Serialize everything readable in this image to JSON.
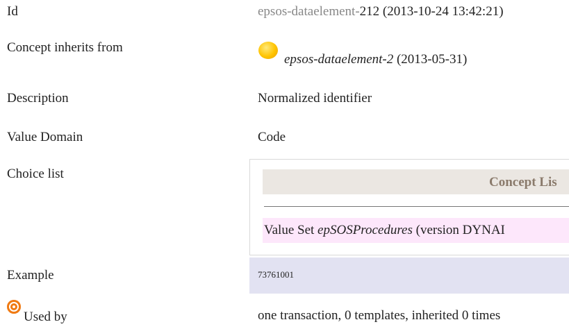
{
  "rows": {
    "id": {
      "label": "Id",
      "value_prefix": "epsos-dataelement-",
      "value_number": "212",
      "value_date": "(2013-10-24 13:42:21)"
    },
    "inherits": {
      "label": "Concept inherits from",
      "value_name": "epsos-dataelement-2",
      "value_date": "(2013-05-31)",
      "icon": "yellow-orb-icon"
    },
    "description": {
      "label": "Description",
      "value": "Normalized identifier"
    },
    "value_domain": {
      "label": "Value Domain",
      "value": "Code"
    },
    "choice_list": {
      "label": "Choice list",
      "concept_list_header": "Concept Lis",
      "value_set_prefix": "Value Set ",
      "value_set_name": "epSOSProcedures",
      "value_set_version": "(version DYNAI"
    },
    "example": {
      "label": "Example",
      "value": "73761001"
    },
    "used_by": {
      "label": "Used by",
      "icon": "target-icon",
      "value": "one transaction, 0 templates, inherited 0 times"
    }
  },
  "colors": {
    "concept_header_bg": "#ebe7e2",
    "value_set_bg": "#fde7fb",
    "example_bg": "#e2e2f2",
    "icon_orange": "#f07a12",
    "orb_yellow": "#ffc400"
  }
}
